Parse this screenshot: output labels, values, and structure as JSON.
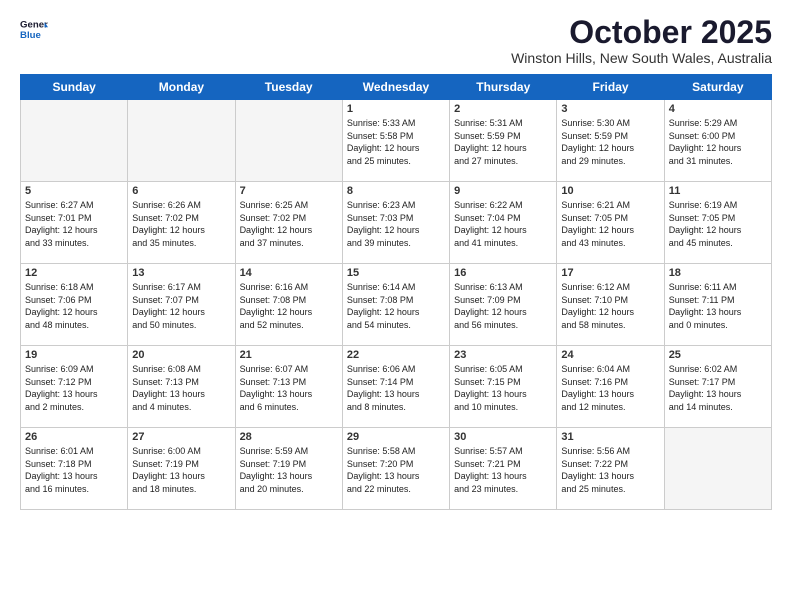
{
  "header": {
    "logo_line1": "General",
    "logo_line2": "Blue",
    "month": "October 2025",
    "location": "Winston Hills, New South Wales, Australia"
  },
  "weekdays": [
    "Sunday",
    "Monday",
    "Tuesday",
    "Wednesday",
    "Thursday",
    "Friday",
    "Saturday"
  ],
  "weeks": [
    [
      {
        "day": "",
        "info": ""
      },
      {
        "day": "",
        "info": ""
      },
      {
        "day": "",
        "info": ""
      },
      {
        "day": "1",
        "info": "Sunrise: 5:33 AM\nSunset: 5:58 PM\nDaylight: 12 hours\nand 25 minutes."
      },
      {
        "day": "2",
        "info": "Sunrise: 5:31 AM\nSunset: 5:59 PM\nDaylight: 12 hours\nand 27 minutes."
      },
      {
        "day": "3",
        "info": "Sunrise: 5:30 AM\nSunset: 5:59 PM\nDaylight: 12 hours\nand 29 minutes."
      },
      {
        "day": "4",
        "info": "Sunrise: 5:29 AM\nSunset: 6:00 PM\nDaylight: 12 hours\nand 31 minutes."
      }
    ],
    [
      {
        "day": "5",
        "info": "Sunrise: 6:27 AM\nSunset: 7:01 PM\nDaylight: 12 hours\nand 33 minutes."
      },
      {
        "day": "6",
        "info": "Sunrise: 6:26 AM\nSunset: 7:02 PM\nDaylight: 12 hours\nand 35 minutes."
      },
      {
        "day": "7",
        "info": "Sunrise: 6:25 AM\nSunset: 7:02 PM\nDaylight: 12 hours\nand 37 minutes."
      },
      {
        "day": "8",
        "info": "Sunrise: 6:23 AM\nSunset: 7:03 PM\nDaylight: 12 hours\nand 39 minutes."
      },
      {
        "day": "9",
        "info": "Sunrise: 6:22 AM\nSunset: 7:04 PM\nDaylight: 12 hours\nand 41 minutes."
      },
      {
        "day": "10",
        "info": "Sunrise: 6:21 AM\nSunset: 7:05 PM\nDaylight: 12 hours\nand 43 minutes."
      },
      {
        "day": "11",
        "info": "Sunrise: 6:19 AM\nSunset: 7:05 PM\nDaylight: 12 hours\nand 45 minutes."
      }
    ],
    [
      {
        "day": "12",
        "info": "Sunrise: 6:18 AM\nSunset: 7:06 PM\nDaylight: 12 hours\nand 48 minutes."
      },
      {
        "day": "13",
        "info": "Sunrise: 6:17 AM\nSunset: 7:07 PM\nDaylight: 12 hours\nand 50 minutes."
      },
      {
        "day": "14",
        "info": "Sunrise: 6:16 AM\nSunset: 7:08 PM\nDaylight: 12 hours\nand 52 minutes."
      },
      {
        "day": "15",
        "info": "Sunrise: 6:14 AM\nSunset: 7:08 PM\nDaylight: 12 hours\nand 54 minutes."
      },
      {
        "day": "16",
        "info": "Sunrise: 6:13 AM\nSunset: 7:09 PM\nDaylight: 12 hours\nand 56 minutes."
      },
      {
        "day": "17",
        "info": "Sunrise: 6:12 AM\nSunset: 7:10 PM\nDaylight: 12 hours\nand 58 minutes."
      },
      {
        "day": "18",
        "info": "Sunrise: 6:11 AM\nSunset: 7:11 PM\nDaylight: 13 hours\nand 0 minutes."
      }
    ],
    [
      {
        "day": "19",
        "info": "Sunrise: 6:09 AM\nSunset: 7:12 PM\nDaylight: 13 hours\nand 2 minutes."
      },
      {
        "day": "20",
        "info": "Sunrise: 6:08 AM\nSunset: 7:13 PM\nDaylight: 13 hours\nand 4 minutes."
      },
      {
        "day": "21",
        "info": "Sunrise: 6:07 AM\nSunset: 7:13 PM\nDaylight: 13 hours\nand 6 minutes."
      },
      {
        "day": "22",
        "info": "Sunrise: 6:06 AM\nSunset: 7:14 PM\nDaylight: 13 hours\nand 8 minutes."
      },
      {
        "day": "23",
        "info": "Sunrise: 6:05 AM\nSunset: 7:15 PM\nDaylight: 13 hours\nand 10 minutes."
      },
      {
        "day": "24",
        "info": "Sunrise: 6:04 AM\nSunset: 7:16 PM\nDaylight: 13 hours\nand 12 minutes."
      },
      {
        "day": "25",
        "info": "Sunrise: 6:02 AM\nSunset: 7:17 PM\nDaylight: 13 hours\nand 14 minutes."
      }
    ],
    [
      {
        "day": "26",
        "info": "Sunrise: 6:01 AM\nSunset: 7:18 PM\nDaylight: 13 hours\nand 16 minutes."
      },
      {
        "day": "27",
        "info": "Sunrise: 6:00 AM\nSunset: 7:19 PM\nDaylight: 13 hours\nand 18 minutes."
      },
      {
        "day": "28",
        "info": "Sunrise: 5:59 AM\nSunset: 7:19 PM\nDaylight: 13 hours\nand 20 minutes."
      },
      {
        "day": "29",
        "info": "Sunrise: 5:58 AM\nSunset: 7:20 PM\nDaylight: 13 hours\nand 22 minutes."
      },
      {
        "day": "30",
        "info": "Sunrise: 5:57 AM\nSunset: 7:21 PM\nDaylight: 13 hours\nand 23 minutes."
      },
      {
        "day": "31",
        "info": "Sunrise: 5:56 AM\nSunset: 7:22 PM\nDaylight: 13 hours\nand 25 minutes."
      },
      {
        "day": "",
        "info": ""
      }
    ]
  ]
}
